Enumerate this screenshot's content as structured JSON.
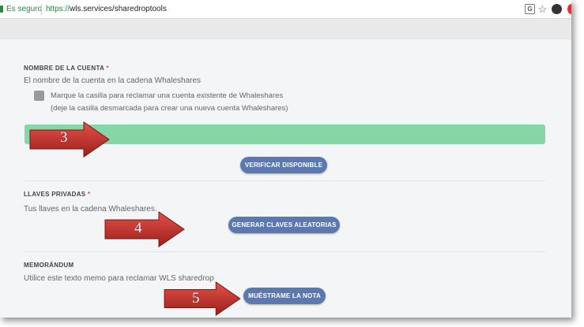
{
  "browser": {
    "secure_label": "Es seguro",
    "url_scheme": "https://",
    "url_rest": "wls.services/sharedroptools",
    "translate_icon": "translate-icon",
    "bookmark_icon": "star-icon"
  },
  "account": {
    "label": "NOMBRE DE LA CUENTA",
    "required_mark": "*",
    "description": "El nombre de la cuenta en la cadena Whaleshares",
    "checkbox_line1": "Marque la casilla para reclamar una cuenta existente de Whaleshares",
    "checkbox_line2": "(deje la casilla desmarcada para crear una nueva cuenta Whaleshares)",
    "input_value": "",
    "verify_button": "VERIFICAR DISPONIBLE"
  },
  "keys": {
    "label": "LLAVES PRIVADAS",
    "required_mark": "*",
    "description": "Tus llaves en la cadena Whaleshares.",
    "generate_button": "GENERAR CLAVES ALEATORIAS"
  },
  "memo": {
    "label": "MEMORÁNDUM",
    "description": "Utilice este texto memo para reclamar WLS sharedrop",
    "show_button": "MUÉSTRAME LA NOTA"
  },
  "annotations": {
    "arrow_3": "3",
    "arrow_4": "4",
    "arrow_5": "5"
  },
  "colors": {
    "accent_button": "#5c78b0",
    "success_field": "#86d6a6",
    "annotation_arrow": "#c0302a"
  }
}
